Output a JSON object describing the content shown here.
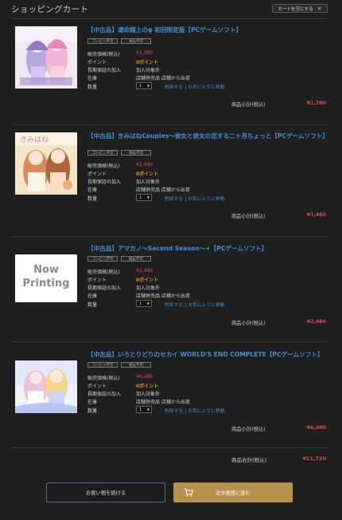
{
  "header": {
    "title": "ショッピングカート",
    "clear_label": "カートを空にする",
    "clear_icon": "close-icon"
  },
  "labels": {
    "price": "販売価格(税込)",
    "points": "ポイント",
    "warranty": "長期保証の加入",
    "stock": "在庫",
    "quantity": "数量",
    "delete": "削除する",
    "favorite": "お気に入りに移動",
    "subtotal": "商品小計(税込)",
    "total": "商品合計(税込)"
  },
  "items": [
    {
      "title": "【中古品】運命線上のφ 初回限定版【PCゲームソフト】",
      "tags": [
        "コンビニ不可",
        "後払不可"
      ],
      "price": "¥1,380",
      "points": "0ポイント",
      "warranty": "加入対象外",
      "stock": "店舗併売品  店舗から出荷",
      "qty": "1",
      "subtotal": "¥1,380"
    },
    {
      "title": "【中古品】きみはねCouples〜彼女と彼女の恋する二ヶ月ちょっと【PCゲームソフト】",
      "tags": [
        "コンビニ不可",
        "後払不可"
      ],
      "price": "¥1,480",
      "points": "0ポイント",
      "warranty": "加入対象外",
      "stock": "店舗併売品  店舗から出荷",
      "qty": "1",
      "subtotal": "¥1,480"
    },
    {
      "title": "【中古品】アマカノ〜Second Season〜+【PCゲームソフト】",
      "tags": [
        "コンビニ不可",
        "後払不可"
      ],
      "price": "¥2,480",
      "points": "0ポイント",
      "warranty": "加入対象外",
      "stock": "店舗併売品  店舗から出荷",
      "qty": "1",
      "subtotal": "¥2,480",
      "image_text": [
        "Now",
        "Printing"
      ]
    },
    {
      "title": "【中古品】いろとりどりのセカイ WORLD'S END COMPLETE【PCゲームソフト】",
      "tags": [
        "コンビニ不可",
        "後払不可"
      ],
      "price": "¥6,480",
      "points": "0ポイント",
      "warranty": "加入対象外",
      "stock": "店舗併売品  店舗から出荷",
      "qty": "1",
      "subtotal": "¥6,480"
    }
  ],
  "total": "¥11,720",
  "buttons": {
    "continue": "お買い物を続ける",
    "order": "注文画面に進む"
  },
  "colors": {
    "background": "#1f1f1f",
    "link": "#3b8fd8",
    "price": "#e04848",
    "points": "#e28a2b",
    "order_button": "#b9914f"
  }
}
